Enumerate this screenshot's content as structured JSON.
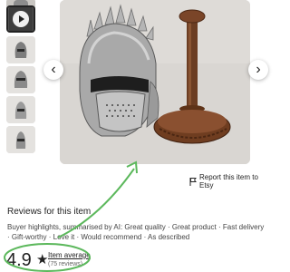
{
  "gallery": {
    "thumbnails": [
      {
        "kind": "video",
        "icon": "play-icon"
      },
      {
        "kind": "image"
      },
      {
        "kind": "image"
      },
      {
        "kind": "image"
      },
      {
        "kind": "image"
      }
    ],
    "selected_index": 0
  },
  "main_image": {
    "prev_icon": "‹",
    "next_icon": "›"
  },
  "report": {
    "icon": "flag-icon",
    "label": "Report this item to Etsy"
  },
  "reviews": {
    "heading": "Reviews for this item",
    "highlights_label": "Buyer highlights, summarised by AI: ",
    "highlights_text": "Great quality · Great product · Fast delivery · Gift-worthy · Love it · Would recommend · As described",
    "rating": "4.9",
    "star_icon": "★",
    "average_label": "Item average",
    "count_label": "(75 reviews)"
  },
  "colors": {
    "annotation": "#5cb85c",
    "text": "#222222",
    "muted": "#666666"
  }
}
